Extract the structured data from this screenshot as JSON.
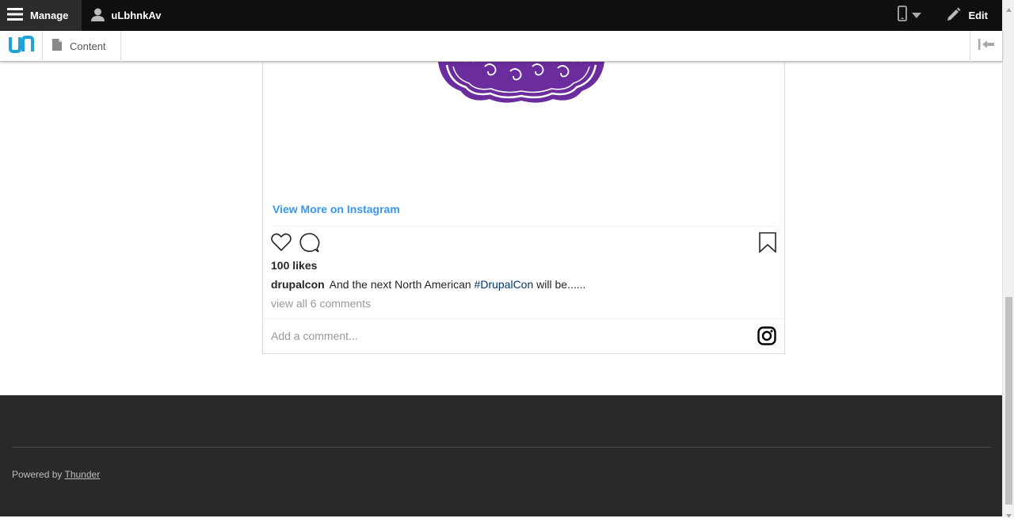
{
  "toolbar": {
    "manage_label": "Manage",
    "user_label": "uLbhnkAv",
    "edit_label": "Edit"
  },
  "tray": {
    "content_label": "Content"
  },
  "instagram": {
    "view_more": "View More on Instagram",
    "likes": "100 likes",
    "caption_user": "drupalcon",
    "caption_text_before": "And the next North American ",
    "caption_hashtag": "#DrupalCon",
    "caption_text_after": " will be......",
    "view_all_comments": "view all 6 comments",
    "add_comment_placeholder": "Add a comment...",
    "colors": {
      "link": "#3897f0",
      "hashtag": "#003569",
      "logo_purple": "#6b2d9e"
    }
  },
  "footer": {
    "powered_by": "Powered by",
    "powered_link": "Thunder"
  }
}
